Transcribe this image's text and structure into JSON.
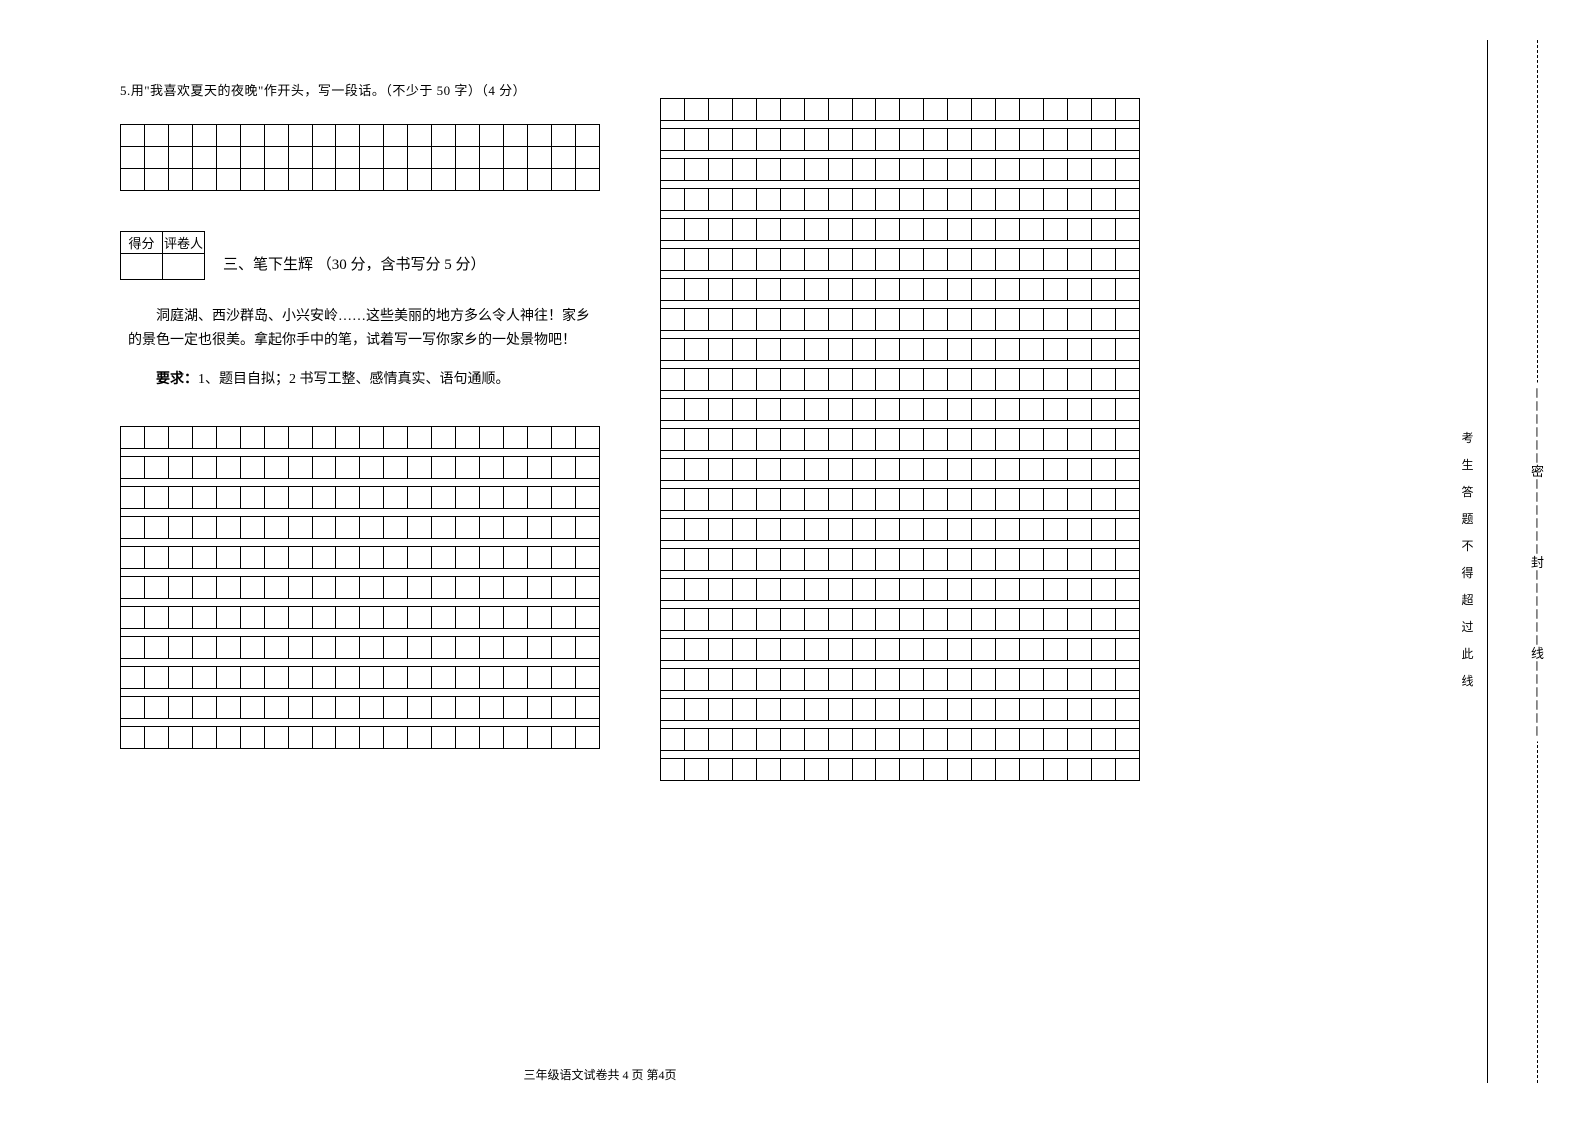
{
  "question5": {
    "number": "5.",
    "text": "用\"我喜欢夏天的夜晚\"作开头，写一段话。（不少于 50 字）（4 分）"
  },
  "scoreTable": {
    "col1": "得分",
    "col2": "评卷人"
  },
  "section3": {
    "title": "三、笔下生辉  （30 分，含书写分 5 分）",
    "intro": "洞庭湖、西沙群岛、小兴安岭……这些美丽的地方多么令人神往！家乡的景色一定也很美。拿起你手中的笔，试着写一写你家乡的一处景物吧！",
    "reqLabel": "要求：",
    "reqText": "1、题目自拟；2 书写工整、感情真实、语句通顺。"
  },
  "footer": "三年级语文试卷共 4 页  第4页",
  "sealLine": {
    "chars": "密－－－－－－封－－－－－－线",
    "innerText": "考 生 答 题 不 得 超 过 此 线"
  },
  "gridConfig": {
    "smallRows": 3,
    "smallCols": 20,
    "leftBigRows": 11,
    "rightBigRows": 23,
    "bigCols": 20
  }
}
